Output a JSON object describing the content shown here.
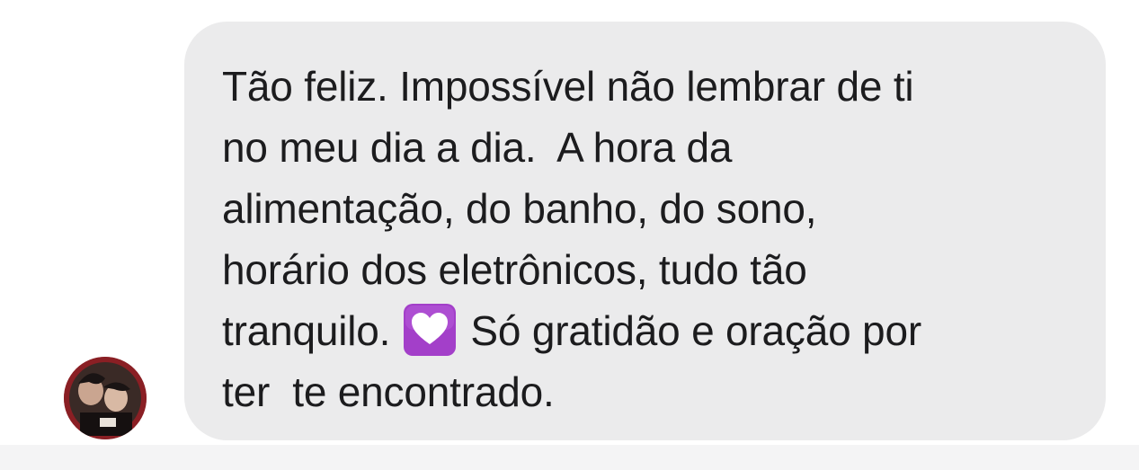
{
  "message": {
    "lines": [
      "Tão feliz. Impossível não lembrar de ti",
      "no meu dia a dia.  A hora da",
      "alimentação, do banho, do sono,",
      "horário dos eletrônicos, tudo tão"
    ],
    "line5_before": "tranquilo. ",
    "line5_after": " Só gratidão e oração por",
    "line6": "ter  te encontrado.",
    "emoji": "purple-heart"
  },
  "colors": {
    "bubble": "#ebebec",
    "text": "#1c1c1e",
    "avatar_ring": "#8a1f24",
    "emoji_bg": "#a33fc9"
  }
}
